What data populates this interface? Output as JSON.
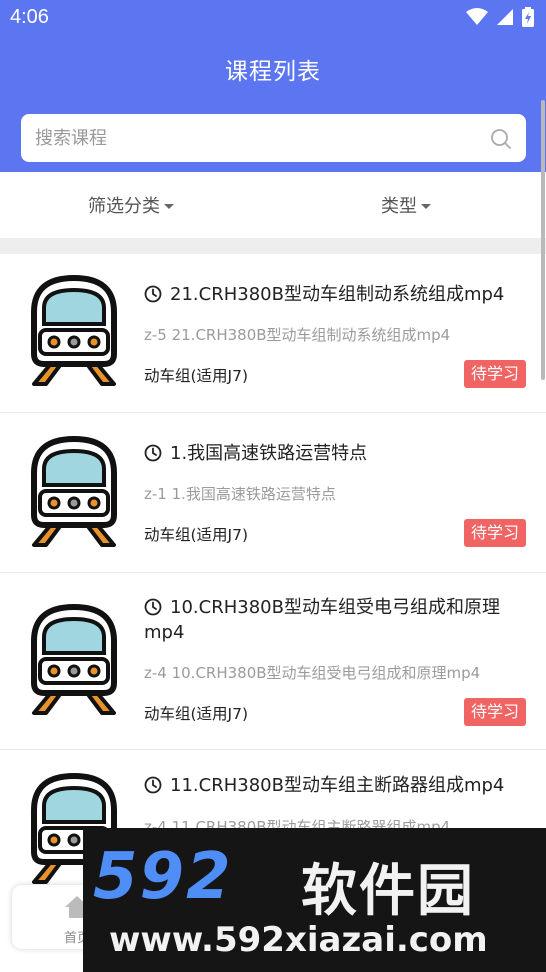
{
  "status_bar": {
    "time": "4:06"
  },
  "header": {
    "title": "课程列表"
  },
  "search": {
    "placeholder": "搜索课程"
  },
  "filters": {
    "category_label": "筛选分类",
    "type_label": "类型"
  },
  "courses": [
    {
      "title": "21.CRH380B型动车组制动系统组成mp4",
      "subtitle": "z-5 21.CRH380B型动车组制动系统组成mp4",
      "category": "动车组(适用J7)",
      "status": "待学习"
    },
    {
      "title": "1.我国高速铁路运营特点",
      "subtitle": "z-1 1.我国高速铁路运营特点",
      "category": "动车组(适用J7)",
      "status": "待学习"
    },
    {
      "title": "10.CRH380B型动车组受电弓组成和原理mp4",
      "subtitle": "z-4 10.CRH380B型动车组受电弓组成和原理mp4",
      "category": "动车组(适用J7)",
      "status": "待学习"
    },
    {
      "title": "11.CRH380B型动车组主断路器组成mp4",
      "subtitle": "z-4 11.CRH380B型动车组主断路器组成mp4",
      "category": "",
      "status": ""
    }
  ],
  "tabbar": {
    "home_label": "首页"
  },
  "watermark": {
    "brand_number": "592",
    "brand_text": "软件园",
    "url": "www.592xiazai.com"
  },
  "colors": {
    "primary": "#5b76f0",
    "badge": "#f06464",
    "thumb_window": "#9fd6df",
    "thumb_rail": "#e8922a"
  }
}
